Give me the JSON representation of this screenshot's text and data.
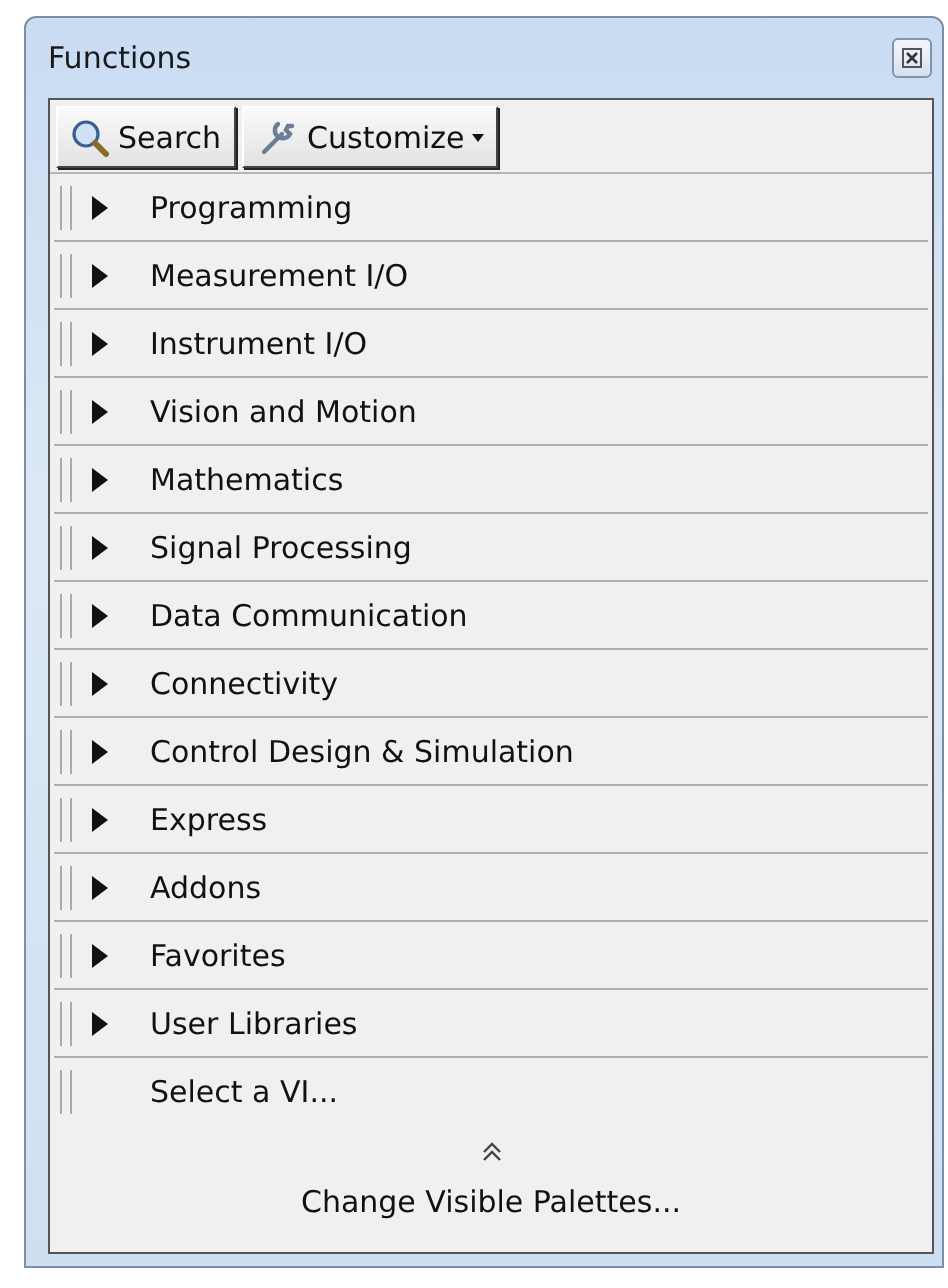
{
  "window": {
    "title": "Functions"
  },
  "toolbar": {
    "search_button": "Search",
    "customize_button": "Customize"
  },
  "items": [
    {
      "kind": "category",
      "label": "Programming",
      "expanded": false
    },
    {
      "kind": "category",
      "label": "Measurement I/O",
      "expanded": false
    },
    {
      "kind": "category",
      "label": "Instrument I/O",
      "expanded": false
    },
    {
      "kind": "category",
      "label": "Vision and Motion",
      "expanded": false
    },
    {
      "kind": "category",
      "label": "Mathematics",
      "expanded": false
    },
    {
      "kind": "category",
      "label": "Signal Processing",
      "expanded": false
    },
    {
      "kind": "category",
      "label": "Data Communication",
      "expanded": false
    },
    {
      "kind": "category",
      "label": "Connectivity",
      "expanded": false
    },
    {
      "kind": "category",
      "label": "Control Design & Simulation",
      "expanded": false
    },
    {
      "kind": "category",
      "label": "Express",
      "expanded": false
    },
    {
      "kind": "category",
      "label": "Addons",
      "expanded": false
    },
    {
      "kind": "category",
      "label": "Favorites",
      "expanded": false
    },
    {
      "kind": "category",
      "label": "User Libraries",
      "expanded": false
    },
    {
      "kind": "action",
      "label": "Select a VI..."
    }
  ],
  "footer": {
    "link": "Change Visible Palettes..."
  }
}
